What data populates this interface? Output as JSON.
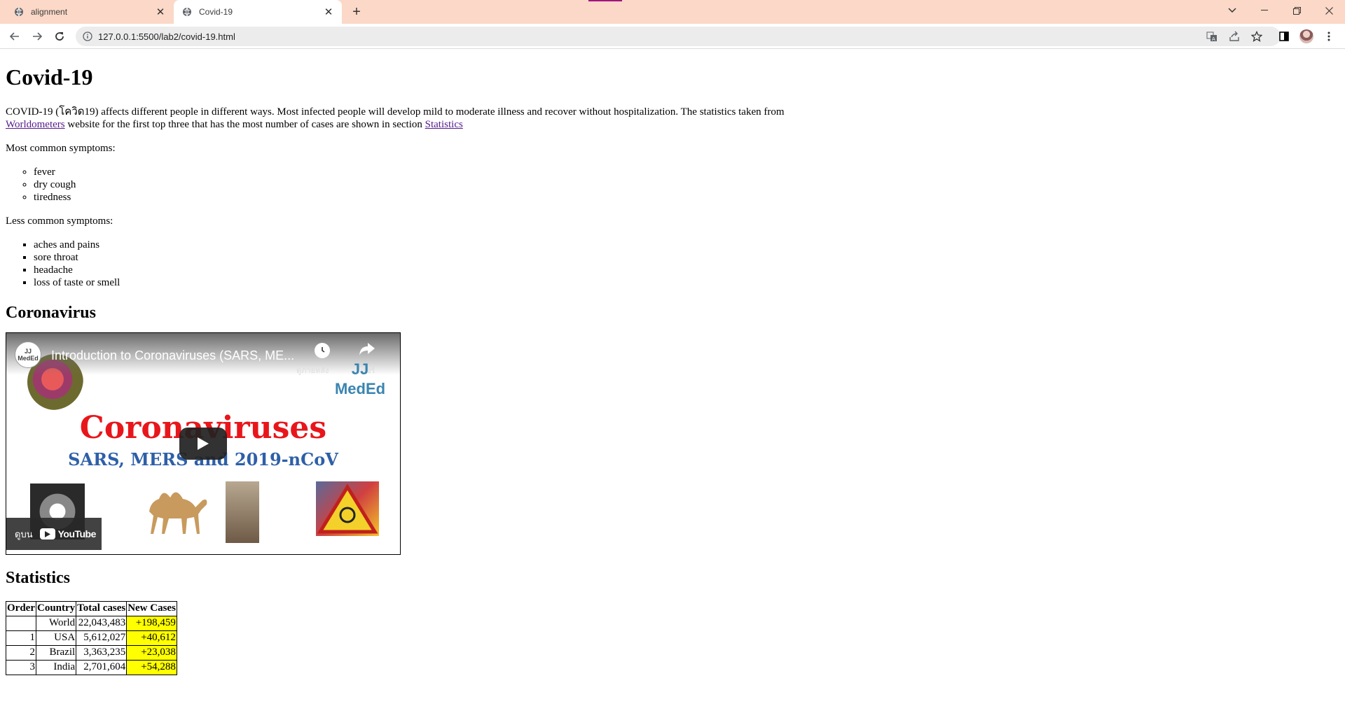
{
  "browser": {
    "tabs": [
      {
        "title": "alignment",
        "active": false
      },
      {
        "title": "Covid-19",
        "active": true
      }
    ],
    "url": "127.0.0.1:5500/lab2/covid-19.html",
    "new_tab_label": "+",
    "icons": {
      "minimize": "minimize-icon",
      "maximize": "restore-icon",
      "close": "close-icon"
    }
  },
  "page": {
    "title": "Covid-19",
    "intro": {
      "text_before": "COVID-19 (โควิด19) affects different people in different ways. Most infected people will develop mild to moderate illness and recover without hospitalization. The statistics taken from",
      "link1": "Worldometers",
      "text_middle": "website for the first top three that has the most number of cases are shown in section",
      "link2": "Statistics"
    },
    "common_label": "Most common symptoms:",
    "common_symptoms": [
      "fever",
      "dry cough",
      "tiredness"
    ],
    "less_common_label": "Less common symptoms:",
    "less_common_symptoms": [
      "aches and pains",
      "sore throat",
      "headache",
      "loss of taste or smell"
    ],
    "coronavirus_heading": "Coronavirus",
    "video": {
      "channel": "JJ MedEd",
      "title": "Introduction to Coronaviruses (SARS, ME...",
      "watch_later": "ดูภายหลัง",
      "share": "แชร์",
      "big_title": "Coronaviruses",
      "sub_title": "SARS, MERS and 2019-nCoV",
      "watch_on": "ดูบน",
      "youtube": "YouTube"
    },
    "statistics_heading": "Statistics",
    "table": {
      "headers": [
        "Order",
        "Country",
        "Total cases",
        "New Cases"
      ],
      "rows": [
        [
          "",
          "World",
          "22,043,483",
          "+198,459"
        ],
        [
          "1",
          "USA",
          "5,612,027",
          "+40,612"
        ],
        [
          "2",
          "Brazil",
          "3,363,235",
          "+23,038"
        ],
        [
          "3",
          "India",
          "2,701,604",
          "+54,288"
        ]
      ],
      "new_cases_highlight": "#ffff00"
    }
  }
}
